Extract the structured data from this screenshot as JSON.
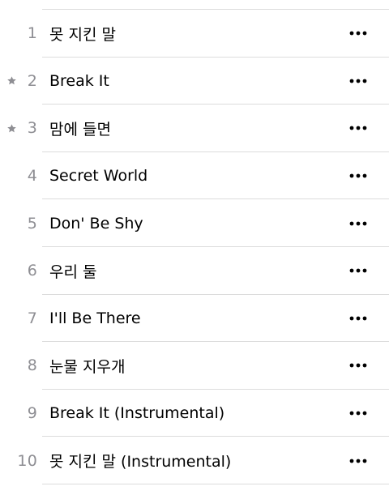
{
  "tracks": [
    {
      "number": "1",
      "title": "못 지킨 말",
      "starred": false
    },
    {
      "number": "2",
      "title": "Break It",
      "starred": true
    },
    {
      "number": "3",
      "title": "맘에 들면",
      "starred": true
    },
    {
      "number": "4",
      "title": "Secret World",
      "starred": false
    },
    {
      "number": "5",
      "title": "Don' Be Shy",
      "starred": false
    },
    {
      "number": "6",
      "title": "우리 둘",
      "starred": false
    },
    {
      "number": "7",
      "title": "I'll Be There",
      "starred": false
    },
    {
      "number": "8",
      "title": "눈물 지우개",
      "starred": false
    },
    {
      "number": "9",
      "title": "Break It (Instrumental)",
      "starred": false
    },
    {
      "number": "10",
      "title": "못 지킨 말 (Instrumental)",
      "starred": false
    }
  ],
  "icons": {
    "star": "star-icon",
    "more": "more-icon"
  },
  "colors": {
    "number": "#8e8e93",
    "star": "#8e8e93",
    "more": "#000000",
    "divider": "#dcdcdc"
  }
}
